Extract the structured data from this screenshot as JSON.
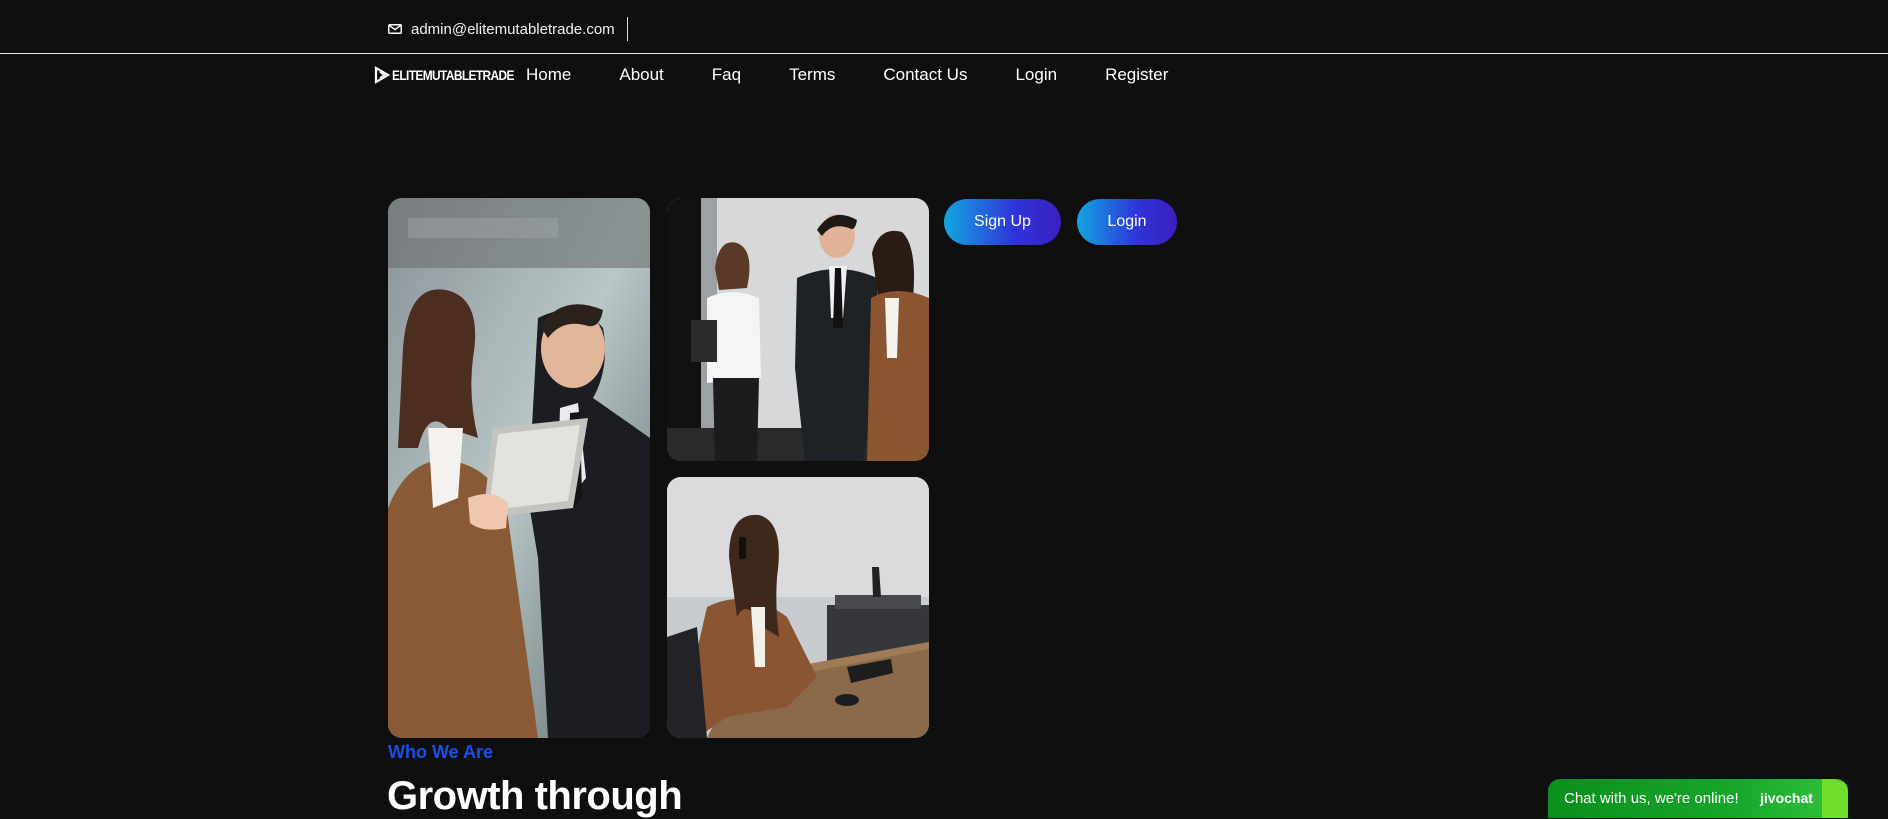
{
  "topbar": {
    "email": "admin@elitemutabletrade.com",
    "icon": "mail-icon"
  },
  "brand": {
    "name": "ELITEMUTABLETRADE"
  },
  "nav": {
    "items": [
      {
        "label": "Home"
      },
      {
        "label": "About"
      },
      {
        "label": "Faq"
      },
      {
        "label": "Terms"
      },
      {
        "label": "Contact Us"
      },
      {
        "label": "Login"
      },
      {
        "label": "Register"
      }
    ]
  },
  "hero": {
    "photos": [
      {
        "alt": "man and woman with tablet"
      },
      {
        "alt": "three colleagues talking"
      },
      {
        "alt": "woman on phone at desk"
      }
    ],
    "signup_label": "Sign Up",
    "login_label": "Login"
  },
  "about": {
    "eyebrow": "Who We Are",
    "headline": "Growth through"
  },
  "chat": {
    "message": "Chat with us, we're online!",
    "brand": "jivochat"
  },
  "colors": {
    "background": "#0f0f0f",
    "accent_blue": "#1b4fe8",
    "button_gradient_start": "#12a6e0",
    "button_gradient_end": "#3a1fbf",
    "chat_green": "#17a52a"
  }
}
